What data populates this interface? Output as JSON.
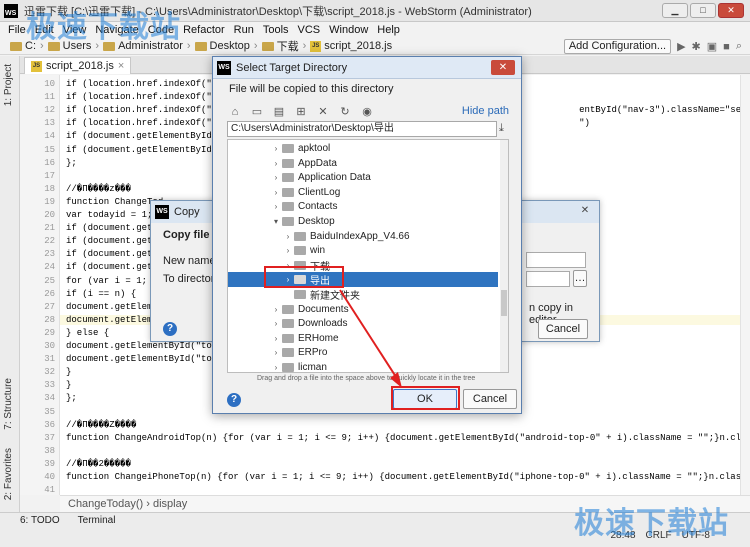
{
  "window": {
    "title": "迅雷下载 [C:\\迅雷下载] - C:\\Users\\Administrator\\Desktop\\下载\\script_2018.js - WebStorm (Administrator)",
    "icon": "webstorm-icon"
  },
  "menu": [
    "File",
    "Edit",
    "View",
    "Navigate",
    "Code",
    "Refactor",
    "Run",
    "Tools",
    "VCS",
    "Window",
    "Help"
  ],
  "breadcrumb": [
    "C:",
    "Users",
    "Administrator",
    "Desktop",
    "下载",
    "script_2018.js"
  ],
  "toolbar": {
    "add_config": "Add Configuration..."
  },
  "editor": {
    "tab": "script_2018.js",
    "line_numbers": [
      "10",
      "11",
      "12",
      "13",
      "14",
      "15",
      "16",
      "17",
      "18",
      "19",
      "20",
      "21",
      "22",
      "23",
      "24",
      "25",
      "26",
      "27",
      "28",
      "29",
      "30",
      "31",
      "32",
      "33",
      "34",
      "35",
      "36",
      "37",
      "38",
      "39",
      "40",
      "41"
    ],
    "lines": [
      "if (location.href.indexOf(\"/news/",
      "if (location.href.indexOf(\"/mac/\"",
      "if (location.href.indexOf(\"/zhuan                                                              entById(\"nav-3\").className=\"selected\")",
      "if (location.href.indexOf(\"/zhuan                                                              \")",
      "if (document.getElementById(\"chan",
      "if (document.getElementById(\"zhus",
      "};",
      "",
      "//�П����z���",
      "function ChangeTod",
      "var todayid = 1;",
      "if (document.getEle",
      "if (document.getEle",
      "if (document.getEle",
      "if (document.getEle",
      "for (var i = 1; i",
      "if (i == n) {",
      "document.getElementB",
      "document.getElementB",
      "} else {",
      "document.getElementById(\"today-ne",
      "document.getElementById(\"today-co",
      "}",
      "}",
      "};",
      "",
      "//�П����Z����",
      "function ChangeAndroidTop(n) {for (var i = 1; i <= 9; i++) {document.getElementById(\"android-top-0\" + i).className = \"\";}n.className = \"selected\";};",
      "",
      "//�П��2�����",
      "function ChangeiPhoneTop(n) {for (var i = 1; i <= 9; i++) {document.getElementById(\"iphone-top-0\" + i).className = \"\";}n.className = \"selected\";};"
    ],
    "footer_crumb": "ChangeToday()  ›  display"
  },
  "left_tabs": [
    "1: Project",
    "7: Structure",
    "2: Favorites"
  ],
  "bottom_tabs": [
    "6: TODO",
    "Terminal"
  ],
  "status": {
    "position": "28:48",
    "line_sep": "CRLF",
    "encoding": "UTF-8"
  },
  "copy_dialog": {
    "title": "Copy",
    "heading": "Copy file C:",
    "new_name_label": "New name:",
    "to_directory_label": "To directory:",
    "open_in_editor": "n copy in editor",
    "cancel": "Cancel"
  },
  "dir_dialog": {
    "title": "Select Target Directory",
    "description": "File will be copied to this directory",
    "hide_path": "Hide path",
    "path": "C:\\Users\\Administrator\\Desktop\\导出",
    "tree": [
      {
        "label": "apktool",
        "level": 0,
        "expanded": false
      },
      {
        "label": "AppData",
        "level": 0,
        "expanded": false
      },
      {
        "label": "Application Data",
        "level": 0,
        "expanded": false
      },
      {
        "label": "ClientLog",
        "level": 0,
        "expanded": false
      },
      {
        "label": "Contacts",
        "level": 0,
        "expanded": false
      },
      {
        "label": "Desktop",
        "level": 0,
        "expanded": true
      },
      {
        "label": "BaiduIndexApp_V4.66",
        "level": 1,
        "expanded": false
      },
      {
        "label": "win",
        "level": 1,
        "expanded": false
      },
      {
        "label": "下载",
        "level": 1,
        "expanded": false
      },
      {
        "label": "导出",
        "level": 1,
        "expanded": false,
        "selected": true
      },
      {
        "label": "新建文件夹",
        "level": 1,
        "leaf": true
      },
      {
        "label": "Documents",
        "level": 0,
        "expanded": false
      },
      {
        "label": "Downloads",
        "level": 0,
        "expanded": false
      },
      {
        "label": "ERHome",
        "level": 0,
        "expanded": false
      },
      {
        "label": "ERPro",
        "level": 0,
        "expanded": false
      },
      {
        "label": "licman",
        "level": 0,
        "expanded": false
      }
    ],
    "hint": "Drag and drop a file into the space above to quickly locate it in the tree",
    "ok": "OK",
    "cancel": "Cancel"
  },
  "watermark": "极速下载站",
  "colors": {
    "selection": "#2f74c0",
    "annotation": "#e02020",
    "watermark": "#1f7fd8"
  }
}
